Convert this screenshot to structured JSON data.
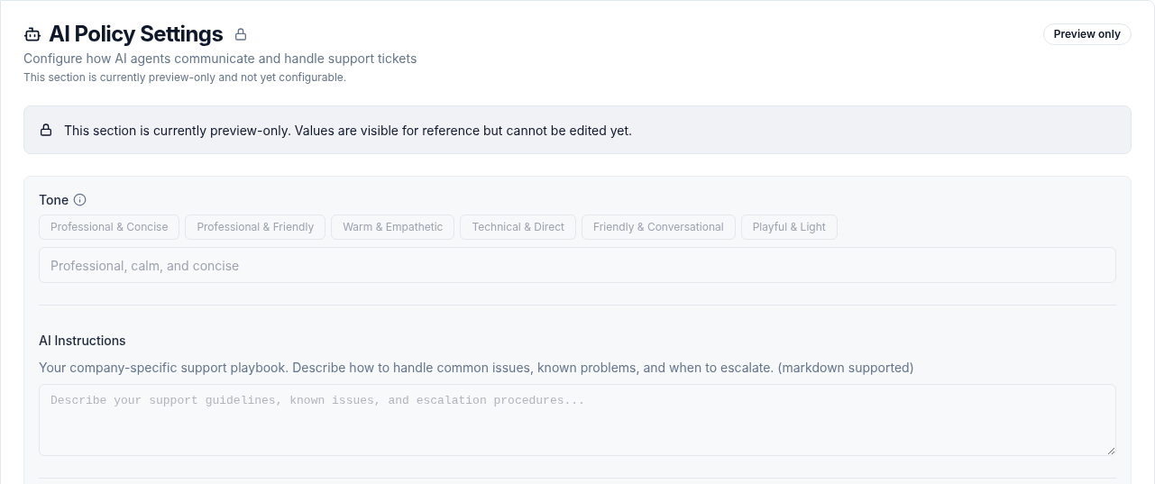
{
  "header": {
    "title": "AI Policy Settings",
    "subtitle": "Configure how AI agents communicate and handle support tickets",
    "note": "This section is currently preview-only and not yet configurable.",
    "badge": "Preview only"
  },
  "banner": {
    "text": "This section is currently preview-only. Values are visible for reference but cannot be edited yet."
  },
  "tone": {
    "label": "Tone",
    "presets": [
      "Professional & Concise",
      "Professional & Friendly",
      "Warm & Empathetic",
      "Technical & Direct",
      "Friendly & Conversational",
      "Playful & Light"
    ],
    "placeholder": "Professional, calm, and concise"
  },
  "instructions": {
    "label": "AI Instructions",
    "description": "Your company-specific support playbook. Describe how to handle common issues, known problems, and when to escalate. (markdown supported)",
    "placeholder": "Describe your support guidelines, known issues, and escalation procedures..."
  }
}
